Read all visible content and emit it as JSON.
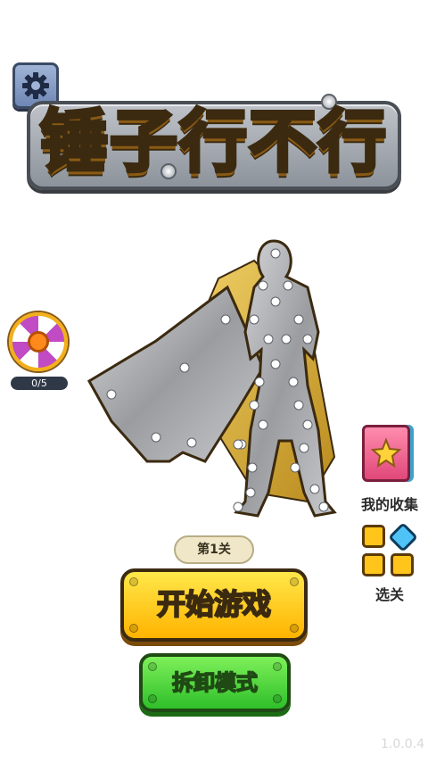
{
  "title": "锤子行不行",
  "wheel": {
    "progress": "0/5"
  },
  "side": {
    "collection_label": "我的收集",
    "levels_label": "选关"
  },
  "level_badge": "第1关",
  "buttons": {
    "start": "开始游戏",
    "disassemble": "拆卸模式"
  },
  "version": "1.0.0.4",
  "colors": {
    "start_button": "#ffc21a",
    "disassemble_button": "#3fd12f",
    "title_fill": "#ffd23a",
    "accent_purple": "#c04bc4"
  },
  "icons": {
    "settings": "gear-icon",
    "wheel": "lucky-wheel-icon",
    "collection": "book-star-icon",
    "levels": "level-tiles-icon"
  }
}
